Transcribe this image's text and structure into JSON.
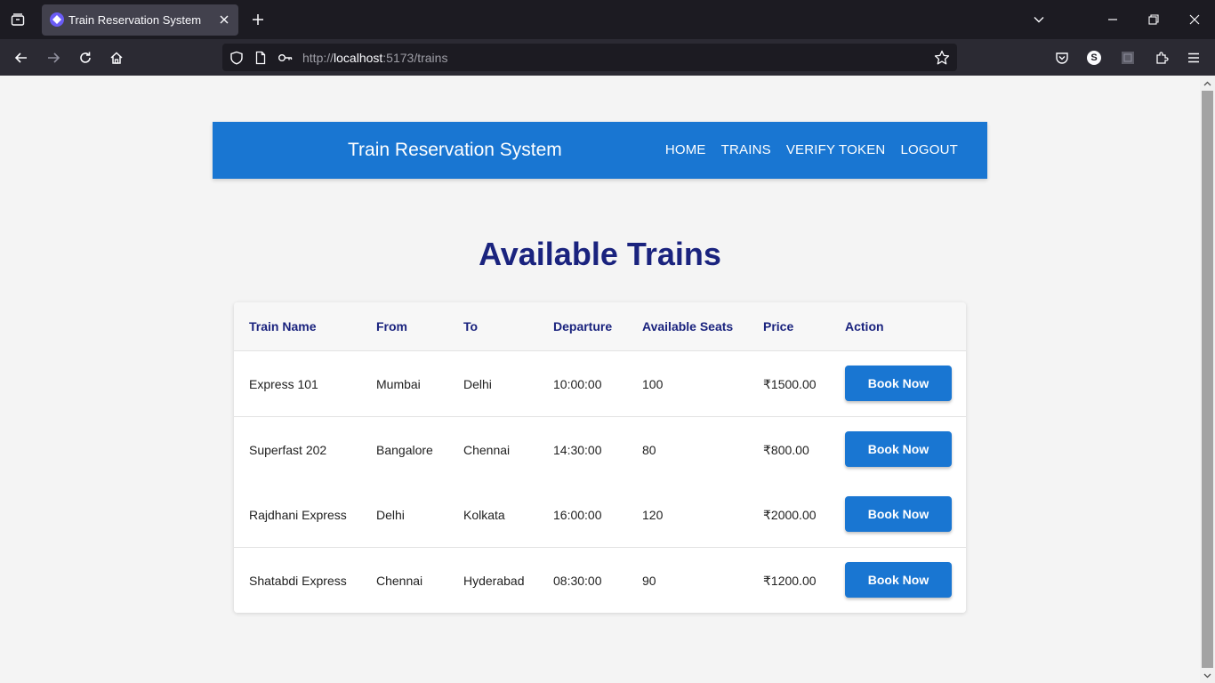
{
  "browser": {
    "tab_title": "Train Reservation System",
    "url_prefix": "http://",
    "url_host": "localhost",
    "url_rest": ":5173/trains",
    "profile_initial": "S"
  },
  "header": {
    "title": "Train Reservation System",
    "nav": [
      {
        "label": "HOME"
      },
      {
        "label": "TRAINS"
      },
      {
        "label": "VERIFY TOKEN"
      },
      {
        "label": "LOGOUT"
      }
    ]
  },
  "main": {
    "heading": "Available Trains",
    "columns": [
      "Train Name",
      "From",
      "To",
      "Departure",
      "Available Seats",
      "Price",
      "Action"
    ],
    "rows": [
      {
        "name": "Express 101",
        "from": "Mumbai",
        "to": "Delhi",
        "departure": "10:00:00",
        "seats": "100",
        "price": "₹1500.00",
        "action": "Book Now"
      },
      {
        "name": "Superfast 202",
        "from": "Bangalore",
        "to": "Chennai",
        "departure": "14:30:00",
        "seats": "80",
        "price": "₹800.00",
        "action": "Book Now"
      },
      {
        "name": "Rajdhani Express",
        "from": "Delhi",
        "to": "Kolkata",
        "departure": "16:00:00",
        "seats": "120",
        "price": "₹2000.00",
        "action": "Book Now"
      },
      {
        "name": "Shatabdi Express",
        "from": "Chennai",
        "to": "Hyderabad",
        "departure": "08:30:00",
        "seats": "90",
        "price": "₹1200.00",
        "action": "Book Now"
      }
    ]
  },
  "colors": {
    "header_bg": "#1976d2",
    "heading": "#1a237e",
    "button": "#1976d2"
  },
  "icons": {
    "tab_list": "tab-list-icon",
    "favicon": "app-favicon-icon",
    "close": "close-icon",
    "new_tab": "plus-icon",
    "back": "back-arrow-icon",
    "forward": "forward-arrow-icon",
    "reload": "reload-icon",
    "home": "home-icon",
    "shield": "shield-icon",
    "page": "page-icon",
    "key": "key-icon",
    "star": "star-icon",
    "pocket": "pocket-icon",
    "extensions": "puzzle-icon",
    "menu": "hamburger-menu-icon"
  }
}
